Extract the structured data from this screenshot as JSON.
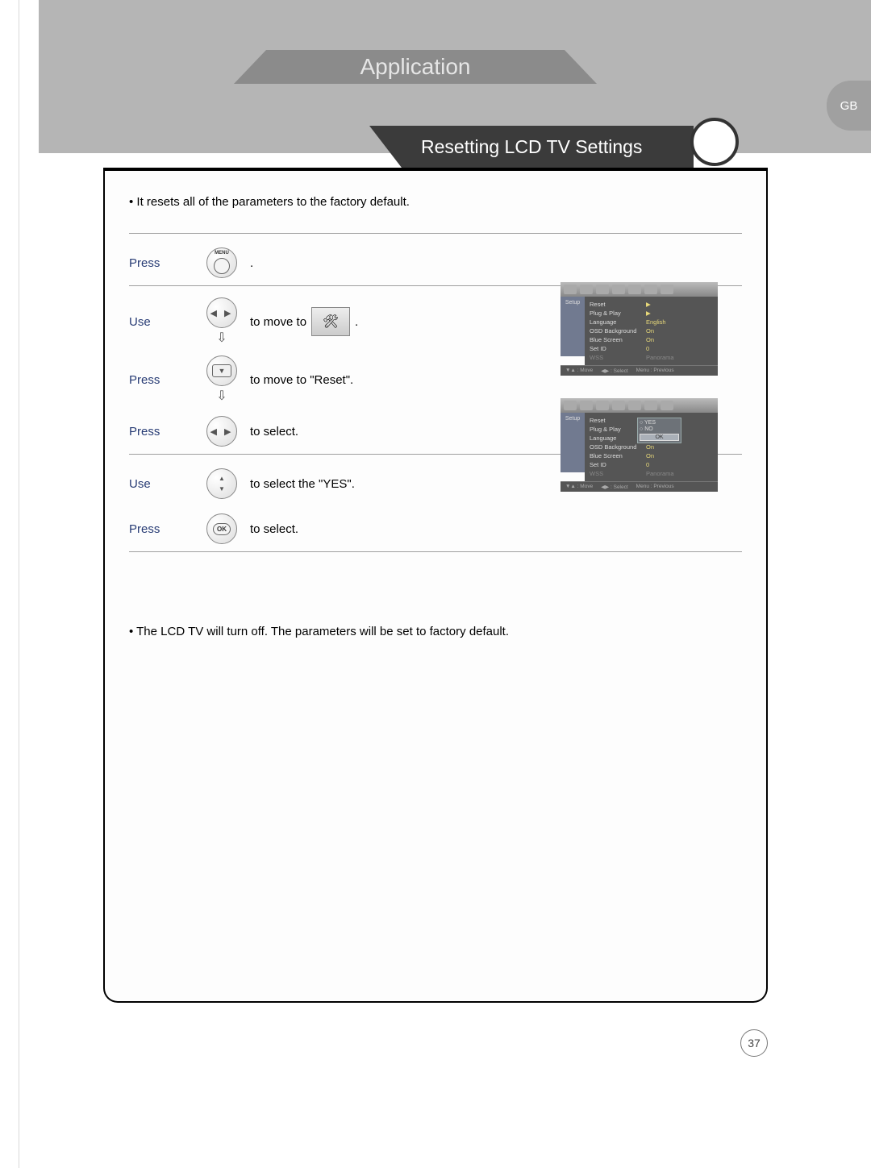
{
  "tab_banner": "Application",
  "locale_tab": "GB",
  "section_title": "Resetting LCD TV Settings",
  "intro_bullet": "• It resets all of the parameters to the factory default.",
  "footer_bullet": "• The LCD TV will turn off. The parameters will be set to factory default.",
  "page_number": "37",
  "steps": [
    {
      "verb": "Press",
      "key": "MENU",
      "after_pre": "",
      "after_post": "."
    },
    {
      "verb": "Use",
      "key": "LEFT/RIGHT",
      "after_pre": "to move to ",
      "after_post": " ."
    },
    {
      "verb": "Press",
      "key": "DOWN",
      "after_pre": "to move to  \"Reset\".",
      "after_post": ""
    },
    {
      "verb": "Press",
      "key": "LEFT/RIGHT",
      "after_pre": "to select.",
      "after_post": ""
    },
    {
      "verb": "Use",
      "key": "UP/DOWN",
      "after_pre": "to select the \"YES\".",
      "after_post": ""
    },
    {
      "verb": "Press",
      "key": "OK",
      "after_pre": "to select.",
      "after_post": ""
    }
  ],
  "osd": {
    "side_label": "Setup",
    "rows": [
      {
        "label": "Reset",
        "value": "▶"
      },
      {
        "label": "Plug & Play",
        "value": "▶"
      },
      {
        "label": "Language",
        "value": "English"
      },
      {
        "label": "OSD Background",
        "value": "On"
      },
      {
        "label": "Blue Screen",
        "value": "On"
      },
      {
        "label": "Set ID",
        "value": "0"
      },
      {
        "label": "WSS",
        "value": "Panorama",
        "dim": true
      }
    ],
    "footer": [
      "▼▲ : Move",
      "◀▶ : Select",
      "Menu : Previous"
    ]
  },
  "osd_popup": {
    "yes": "YES",
    "no": "NO",
    "ok": "OK"
  },
  "key_labels": {
    "menu": "MENU",
    "ok": "OK"
  }
}
